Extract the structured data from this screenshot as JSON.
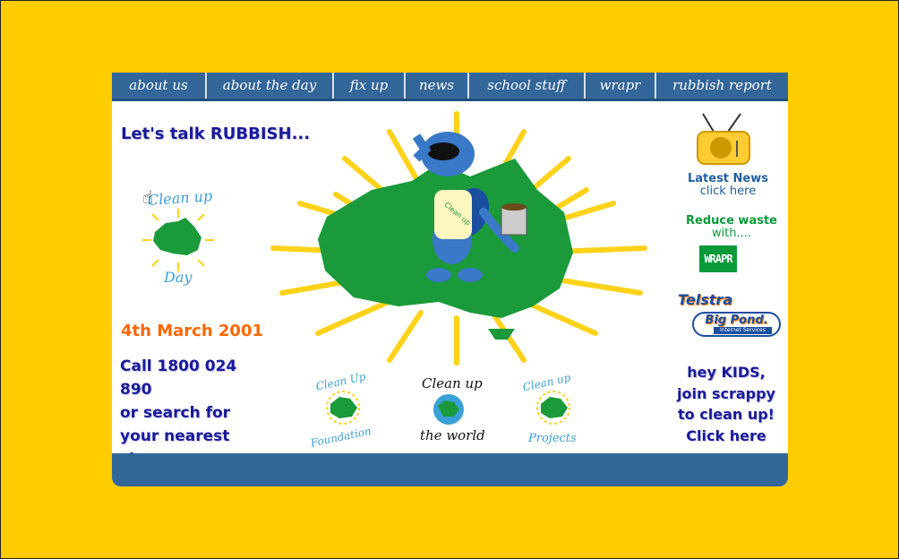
{
  "nav": {
    "items": [
      {
        "label": "about us"
      },
      {
        "label": "about the day"
      },
      {
        "label": "fix up"
      },
      {
        "label": "news"
      },
      {
        "label": "school stuff"
      },
      {
        "label": "wrapr"
      },
      {
        "label": "rubbish report"
      }
    ]
  },
  "main": {
    "headline": "Let's talk RUBBISH...",
    "date": "4th March 2001",
    "call_lines": [
      "Call 1800 024 890",
      "or search for",
      "your nearest",
      "site."
    ],
    "cleanup_day_logo": {
      "top": "Clean up",
      "bottom": "Day"
    },
    "mascot": {
      "apron_text": "Clean up"
    }
  },
  "sidebar": {
    "news": {
      "title": "Latest News",
      "link": "click here"
    },
    "reduce": {
      "title": "Reduce waste",
      "sub": "with....",
      "logo": "WRAPR"
    },
    "sponsor": {
      "brand": "Telstra",
      "product": "Big Pond.",
      "sub": "Internet Services"
    },
    "kids_lines": [
      "hey KIDS,",
      "join scrappy",
      "to clean up!",
      "Click here"
    ]
  },
  "bottom_logos": {
    "foundation": {
      "top": "Clean Up",
      "bottom": "Foundation"
    },
    "world": {
      "top": "Clean up",
      "bottom": "the world"
    },
    "projects": {
      "top": "Clean up",
      "bottom": "Projects"
    }
  },
  "colors": {
    "background": "#ffcc00",
    "nav": "#336699",
    "headline": "#1a1a99",
    "date": "#ff6600",
    "australia": "#1a9a3a",
    "sunrays": "#ffd21a"
  }
}
